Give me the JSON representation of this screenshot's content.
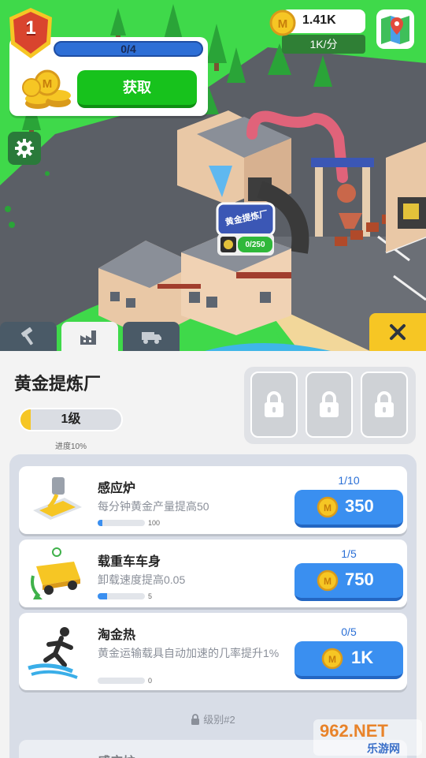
{
  "hud": {
    "player_level": "1",
    "quest_progress": "0/4",
    "get_button": "获取",
    "currency_amount": "1.41K",
    "currency_rate": "1K/分"
  },
  "scene": {
    "factory_sign": "黄金提炼厂",
    "factory_capacity": "0/250"
  },
  "tabs": [
    {
      "name": "tools",
      "icon": "hammer-icon"
    },
    {
      "name": "factory",
      "icon": "factory-icon"
    },
    {
      "name": "trucks",
      "icon": "truck-icon"
    }
  ],
  "panel": {
    "title": "黄金提炼厂",
    "level_label": "1级",
    "level_progress": 0.1,
    "progress_note": "进度10%",
    "locked_slots": 3,
    "upgrades": [
      {
        "name": "感应炉",
        "description": "每分钟黄金产量提高50",
        "bar_value": "100",
        "bar_fraction": 0.1,
        "count": "1/10",
        "price": "350",
        "icon": "induction-furnace-icon"
      },
      {
        "name": "载重车车身",
        "description": "卸载速度提高0.05",
        "bar_value": "5",
        "bar_fraction": 0.2,
        "count": "1/5",
        "price": "750",
        "icon": "truck-body-icon"
      },
      {
        "name": "淘金热",
        "description": "黄金运输载具自动加速的几率提升1%",
        "bar_value": "0",
        "bar_fraction": 0.0,
        "count": "0/5",
        "price": "1K",
        "icon": "gold-rush-runner-icon"
      }
    ],
    "locked_tier_label": "级别#2",
    "next_upgrade_name": "感应炉"
  },
  "watermark": {
    "line1": "962.NET",
    "line2": "乐游网"
  },
  "colors": {
    "grass": "#3fd94a",
    "road": "#5b5f66",
    "accent_blue": "#3a8ff0",
    "accent_green": "#17c21c",
    "accent_yellow": "#f6c624",
    "badge_red": "#d9442e"
  }
}
